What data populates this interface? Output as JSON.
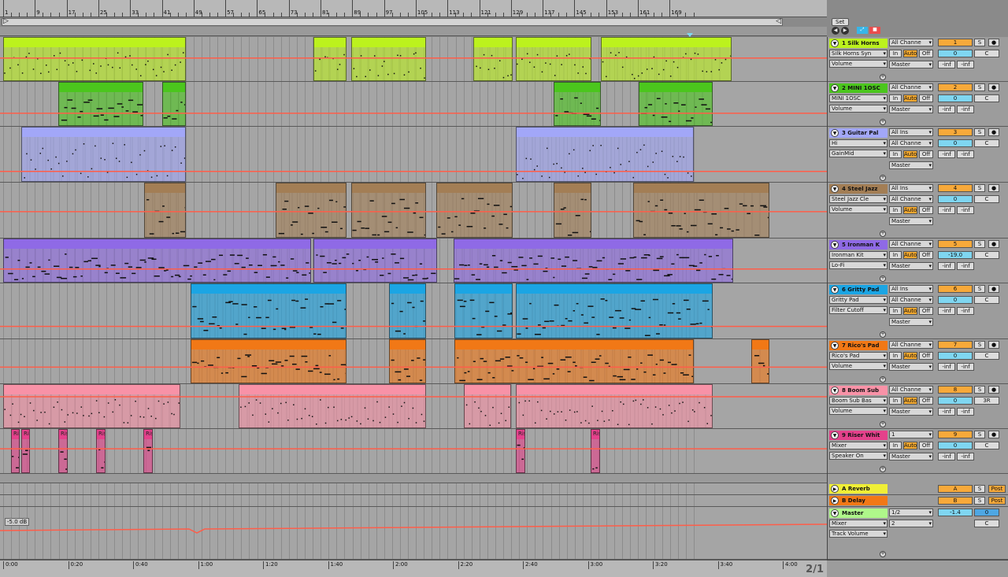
{
  "ruler": {
    "bars": [
      "1",
      "9",
      "17",
      "25",
      "33",
      "41",
      "49",
      "57",
      "65",
      "73",
      "81",
      "89",
      "97",
      "105",
      "113",
      "121",
      "129",
      "137",
      "145",
      "153",
      "161",
      "169"
    ]
  },
  "set_button": "Set",
  "timeline": {
    "labels": [
      "0:00",
      "0:20",
      "0:40",
      "1:00",
      "1:20",
      "1:40",
      "2:00",
      "2:20",
      "2:40",
      "3:00",
      "3:20",
      "3:40",
      "4:00"
    ]
  },
  "pager": "2/1",
  "master_db_label": "-5.0 dB",
  "colors": {
    "silk": "#bcf21d",
    "mini": "#4bc61d",
    "guitar": "#a2a7f8",
    "steel": "#a37e55",
    "ironman": "#8f6ae6",
    "gritty": "#1ba5e4",
    "rico": "#f17816",
    "boom": "#f892a7",
    "riser": "#e4418b",
    "reverb": "#f0ef36",
    "delay": "#f17816",
    "master": "#aff78a",
    "automation": "#ff5d49"
  },
  "tracks": [
    {
      "num": "1",
      "name": "1 Silk Horns",
      "input": "Silk Horns Syn",
      "auto_param": "Volume",
      "chan": "All Channe",
      "out": "Master",
      "mon": "1",
      "vol": "0",
      "pan": "C",
      "send1": "-inf",
      "send2": "-inf",
      "color": "#bcf21d"
    },
    {
      "num": "2",
      "name": "2 MINI 1OSC",
      "input": "MINI 1OSC",
      "auto_param": "Volume",
      "chan": "All Channe",
      "out": "Master",
      "mon": "2",
      "vol": "0",
      "pan": "C",
      "send1": "-inf",
      "send2": "-inf",
      "color": "#4bc61d"
    },
    {
      "num": "3",
      "name": "3 Guitar Pal",
      "input": "Hi",
      "auto_param": "GainMid",
      "chan": "All Channe",
      "inlabel": "All Ins",
      "out": "Master",
      "mon": "3",
      "vol": "0",
      "pan": "C",
      "send1": "-inf",
      "send2": "-inf",
      "color": "#a2a7f8"
    },
    {
      "num": "4",
      "name": "4 Steel Jazz",
      "input": "Steel Jazz Cle",
      "auto_param": "Volume",
      "chan": "All Channe",
      "inlabel": "All Ins",
      "out": "Master",
      "mon": "4",
      "vol": "0",
      "pan": "C",
      "send1": "-inf",
      "send2": "-inf",
      "color": "#a37e55"
    },
    {
      "num": "5",
      "name": "5 Ironman K",
      "input": "Ironman Kit",
      "auto_param": "Lo-Fi",
      "chan": "All Channe",
      "out": "Master",
      "mon": "5",
      "vol": "-19.0",
      "pan": "C",
      "send1": "-inf",
      "send2": "-inf",
      "color": "#8f6ae6"
    },
    {
      "num": "6",
      "name": "6 Gritty Pad",
      "input": "Gritty Pad",
      "auto_param": "Filter Cutoff",
      "chan": "All Channe",
      "inlabel": "All Ins",
      "out": "Master",
      "mon": "6",
      "vol": "0",
      "pan": "C",
      "send1": "-inf",
      "send2": "-inf",
      "color": "#1ba5e4"
    },
    {
      "num": "7",
      "name": "7 Rico's Pad",
      "input": "Rico's Pad",
      "auto_param": "Volume",
      "chan": "All Channe",
      "out": "Master",
      "mon": "7",
      "vol": "0",
      "pan": "C",
      "send1": "-inf",
      "send2": "-inf",
      "color": "#f17816"
    },
    {
      "num": "8",
      "name": "8 Boom Sub",
      "input": "Boom Sub Bas",
      "auto_param": "Volume",
      "chan": "All Channe",
      "out": "Master",
      "mon": "8",
      "vol": "0",
      "pan": "3R",
      "send1": "-inf",
      "send2": "-inf",
      "color": "#f892a7"
    },
    {
      "num": "9",
      "name": "9 Riser Whit",
      "input": "Mixer",
      "auto_param": "Speaker On",
      "chan": "1",
      "out": "Master",
      "mon": "9",
      "vol": "0",
      "pan": "C",
      "send1": "-inf",
      "send2": "-inf",
      "color": "#e4418b"
    }
  ],
  "returns": [
    {
      "name": "A Reverb",
      "letter": "A",
      "post": "Post",
      "color": "#f0ef36"
    },
    {
      "name": "B Delay",
      "letter": "B",
      "post": "Post",
      "color": "#f17816"
    }
  ],
  "master": {
    "name": "Master",
    "input": "Mixer",
    "auto_param": "Track Volume",
    "chan1": "1/2",
    "chan2": "2",
    "vol": "-1.4",
    "vol2": "0",
    "pan": "C"
  },
  "labels": {
    "in": "In",
    "auto": "Auto",
    "off": "Off",
    "s": "S",
    "riser_clip": "Ris"
  }
}
